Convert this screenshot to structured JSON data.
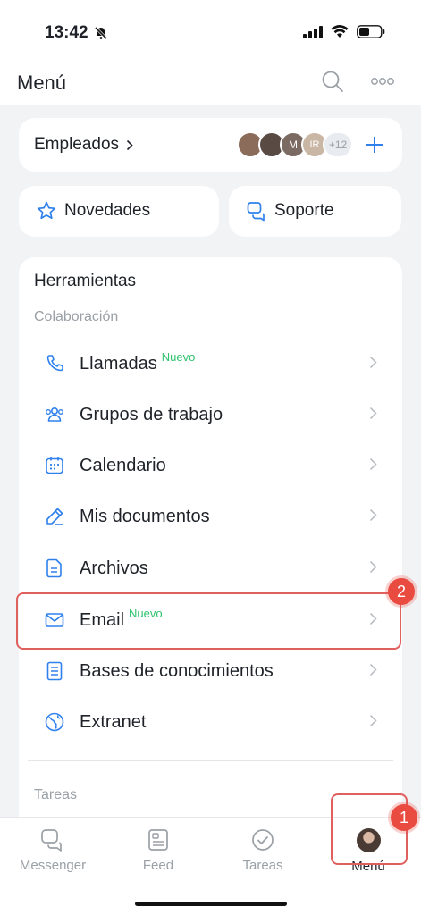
{
  "status_bar": {
    "time": "13:42"
  },
  "header": {
    "title": "Menú"
  },
  "employees": {
    "label": "Empleados",
    "more_count": "+12",
    "avatar_initials": [
      "M",
      "IR"
    ]
  },
  "quick": {
    "news_label": "Novedades",
    "support_label": "Soporte"
  },
  "tools": {
    "title": "Herramientas",
    "section": "Colaboración",
    "items": [
      {
        "label": "Llamadas",
        "badge": "Nuevo",
        "icon": "phone-icon"
      },
      {
        "label": "Grupos de trabajo",
        "badge": "",
        "icon": "group-icon"
      },
      {
        "label": "Calendario",
        "badge": "",
        "icon": "calendar-icon"
      },
      {
        "label": "Mis documentos",
        "badge": "",
        "icon": "pen-icon"
      },
      {
        "label": "Archivos",
        "badge": "",
        "icon": "file-icon"
      },
      {
        "label": "Email",
        "badge": "Nuevo",
        "icon": "mail-icon"
      },
      {
        "label": "Bases de conocimientos",
        "badge": "",
        "icon": "book-icon"
      },
      {
        "label": "Extranet",
        "badge": "",
        "icon": "globe-icon"
      }
    ],
    "next_section": "Tareas"
  },
  "annotations": {
    "step1": "1",
    "step2": "2"
  },
  "tabbar": {
    "items": [
      {
        "label": "Messenger",
        "icon": "chat-icon"
      },
      {
        "label": "Feed",
        "icon": "feed-icon"
      },
      {
        "label": "Tareas",
        "icon": "check-circle-icon"
      },
      {
        "label": "Menú",
        "icon": "profile-avatar"
      }
    ]
  },
  "colors": {
    "accent": "#2f80ed",
    "new_badge": "#2fc26e",
    "annotation": "#e94b40"
  }
}
